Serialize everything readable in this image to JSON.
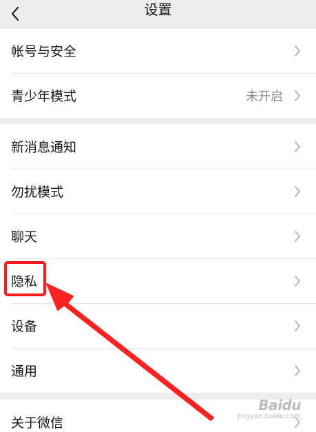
{
  "navbar": {
    "title": "设置"
  },
  "groups": [
    {
      "items": [
        {
          "label": "帐号与安全",
          "value": ""
        },
        {
          "label": "青少年模式",
          "value": "未开启"
        }
      ]
    },
    {
      "items": [
        {
          "label": "新消息通知",
          "value": ""
        },
        {
          "label": "勿扰模式",
          "value": ""
        },
        {
          "label": "聊天",
          "value": ""
        },
        {
          "label": "隐私",
          "value": ""
        },
        {
          "label": "设备",
          "value": ""
        },
        {
          "label": "通用",
          "value": ""
        }
      ]
    },
    {
      "items": [
        {
          "label": "关于微信",
          "value": ""
        }
      ]
    }
  ],
  "annotation": {
    "highlight_color": "#ff1a1a",
    "highlighted_item": "隐私"
  },
  "watermark": {
    "brand": "Baidu",
    "domain": "jingyan.baidu.com"
  },
  "icons": {
    "back": "chevron-left-icon",
    "row_arrow": "chevron-right-icon"
  }
}
